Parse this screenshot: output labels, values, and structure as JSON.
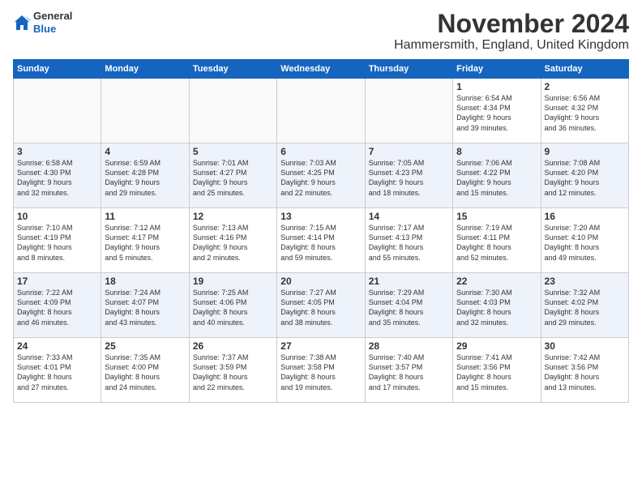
{
  "logo": {
    "general": "General",
    "blue": "Blue"
  },
  "title": "November 2024",
  "location": "Hammersmith, England, United Kingdom",
  "weekdays": [
    "Sunday",
    "Monday",
    "Tuesday",
    "Wednesday",
    "Thursday",
    "Friday",
    "Saturday"
  ],
  "weeks": [
    [
      {
        "day": "",
        "info": ""
      },
      {
        "day": "",
        "info": ""
      },
      {
        "day": "",
        "info": ""
      },
      {
        "day": "",
        "info": ""
      },
      {
        "day": "",
        "info": ""
      },
      {
        "day": "1",
        "info": "Sunrise: 6:54 AM\nSunset: 4:34 PM\nDaylight: 9 hours\nand 39 minutes."
      },
      {
        "day": "2",
        "info": "Sunrise: 6:56 AM\nSunset: 4:32 PM\nDaylight: 9 hours\nand 36 minutes."
      }
    ],
    [
      {
        "day": "3",
        "info": "Sunrise: 6:58 AM\nSunset: 4:30 PM\nDaylight: 9 hours\nand 32 minutes."
      },
      {
        "day": "4",
        "info": "Sunrise: 6:59 AM\nSunset: 4:28 PM\nDaylight: 9 hours\nand 29 minutes."
      },
      {
        "day": "5",
        "info": "Sunrise: 7:01 AM\nSunset: 4:27 PM\nDaylight: 9 hours\nand 25 minutes."
      },
      {
        "day": "6",
        "info": "Sunrise: 7:03 AM\nSunset: 4:25 PM\nDaylight: 9 hours\nand 22 minutes."
      },
      {
        "day": "7",
        "info": "Sunrise: 7:05 AM\nSunset: 4:23 PM\nDaylight: 9 hours\nand 18 minutes."
      },
      {
        "day": "8",
        "info": "Sunrise: 7:06 AM\nSunset: 4:22 PM\nDaylight: 9 hours\nand 15 minutes."
      },
      {
        "day": "9",
        "info": "Sunrise: 7:08 AM\nSunset: 4:20 PM\nDaylight: 9 hours\nand 12 minutes."
      }
    ],
    [
      {
        "day": "10",
        "info": "Sunrise: 7:10 AM\nSunset: 4:19 PM\nDaylight: 9 hours\nand 8 minutes."
      },
      {
        "day": "11",
        "info": "Sunrise: 7:12 AM\nSunset: 4:17 PM\nDaylight: 9 hours\nand 5 minutes."
      },
      {
        "day": "12",
        "info": "Sunrise: 7:13 AM\nSunset: 4:16 PM\nDaylight: 9 hours\nand 2 minutes."
      },
      {
        "day": "13",
        "info": "Sunrise: 7:15 AM\nSunset: 4:14 PM\nDaylight: 8 hours\nand 59 minutes."
      },
      {
        "day": "14",
        "info": "Sunrise: 7:17 AM\nSunset: 4:13 PM\nDaylight: 8 hours\nand 55 minutes."
      },
      {
        "day": "15",
        "info": "Sunrise: 7:19 AM\nSunset: 4:11 PM\nDaylight: 8 hours\nand 52 minutes."
      },
      {
        "day": "16",
        "info": "Sunrise: 7:20 AM\nSunset: 4:10 PM\nDaylight: 8 hours\nand 49 minutes."
      }
    ],
    [
      {
        "day": "17",
        "info": "Sunrise: 7:22 AM\nSunset: 4:09 PM\nDaylight: 8 hours\nand 46 minutes."
      },
      {
        "day": "18",
        "info": "Sunrise: 7:24 AM\nSunset: 4:07 PM\nDaylight: 8 hours\nand 43 minutes."
      },
      {
        "day": "19",
        "info": "Sunrise: 7:25 AM\nSunset: 4:06 PM\nDaylight: 8 hours\nand 40 minutes."
      },
      {
        "day": "20",
        "info": "Sunrise: 7:27 AM\nSunset: 4:05 PM\nDaylight: 8 hours\nand 38 minutes."
      },
      {
        "day": "21",
        "info": "Sunrise: 7:29 AM\nSunset: 4:04 PM\nDaylight: 8 hours\nand 35 minutes."
      },
      {
        "day": "22",
        "info": "Sunrise: 7:30 AM\nSunset: 4:03 PM\nDaylight: 8 hours\nand 32 minutes."
      },
      {
        "day": "23",
        "info": "Sunrise: 7:32 AM\nSunset: 4:02 PM\nDaylight: 8 hours\nand 29 minutes."
      }
    ],
    [
      {
        "day": "24",
        "info": "Sunrise: 7:33 AM\nSunset: 4:01 PM\nDaylight: 8 hours\nand 27 minutes."
      },
      {
        "day": "25",
        "info": "Sunrise: 7:35 AM\nSunset: 4:00 PM\nDaylight: 8 hours\nand 24 minutes."
      },
      {
        "day": "26",
        "info": "Sunrise: 7:37 AM\nSunset: 3:59 PM\nDaylight: 8 hours\nand 22 minutes."
      },
      {
        "day": "27",
        "info": "Sunrise: 7:38 AM\nSunset: 3:58 PM\nDaylight: 8 hours\nand 19 minutes."
      },
      {
        "day": "28",
        "info": "Sunrise: 7:40 AM\nSunset: 3:57 PM\nDaylight: 8 hours\nand 17 minutes."
      },
      {
        "day": "29",
        "info": "Sunrise: 7:41 AM\nSunset: 3:56 PM\nDaylight: 8 hours\nand 15 minutes."
      },
      {
        "day": "30",
        "info": "Sunrise: 7:42 AM\nSunset: 3:56 PM\nDaylight: 8 hours\nand 13 minutes."
      }
    ]
  ]
}
